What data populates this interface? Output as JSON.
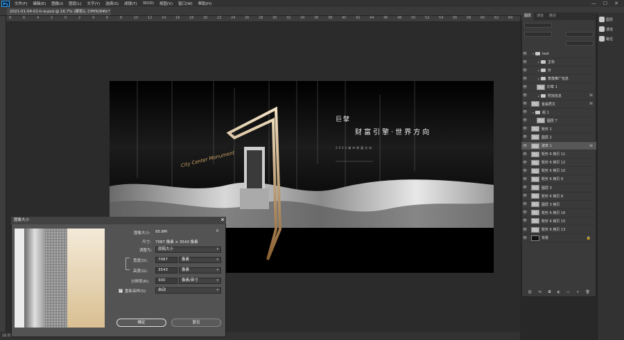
{
  "app": {
    "logo_text": "Ps",
    "menu": [
      "文件(F)",
      "编辑(E)",
      "图像(I)",
      "图层(L)",
      "文字(Y)",
      "选择(S)",
      "滤镜(T)",
      "3D(D)",
      "视图(V)",
      "窗口(W)",
      "帮助(H)"
    ],
    "window_controls": [
      "—",
      "☐",
      "✕"
    ]
  },
  "document": {
    "tab_title": "2021-01-04-01-h-w.psd @ 16.7% (建筑1, CMYK/8#) *",
    "tab_close": "×",
    "status_text": "16.67%"
  },
  "ruler": {
    "top_labels": [
      "8",
      "6",
      "4",
      "2",
      "0",
      "2",
      "4",
      "6",
      "8",
      "10",
      "12",
      "14",
      "16",
      "18",
      "20",
      "22",
      "24",
      "26",
      "28",
      "30",
      "32",
      "34",
      "36",
      "38",
      "40",
      "42",
      "44",
      "46",
      "48",
      "50",
      "52",
      "54",
      "56",
      "58",
      "60",
      "62",
      "64"
    ]
  },
  "artwork": {
    "headline": "巨擘",
    "tagline": "财富引擎·世界方向",
    "subline": "2021城市财富方向",
    "script_text": "City Center Monument"
  },
  "layers_panel": {
    "tabs": [
      "图层",
      "通道",
      "路径"
    ],
    "footer_icons": [
      "link-icon",
      "fx-icon",
      "mask-icon",
      "adjustment-icon",
      "group-icon",
      "new-layer-icon",
      "trash-icon"
    ],
    "footer_glyphs": [
      "⛓",
      "fx",
      "◘",
      "◐",
      "▭",
      "+",
      "🗑"
    ],
    "layers": [
      {
        "name": "text",
        "kind": "group",
        "indent": 0,
        "open": true
      },
      {
        "name": "主标",
        "kind": "group",
        "indent": 1
      },
      {
        "name": "价",
        "kind": "group",
        "indent": 1
      },
      {
        "name": "角落推广信息",
        "kind": "group",
        "indent": 1
      },
      {
        "name": "印章 1",
        "kind": "layer",
        "indent": 1,
        "thumb": "light"
      },
      {
        "name": "附加信息",
        "kind": "group",
        "indent": 1,
        "fx": true
      },
      {
        "name": "金属质文",
        "kind": "layer",
        "indent": 0,
        "thumb": "light",
        "fx": true
      },
      {
        "name": "组 1",
        "kind": "group",
        "indent": 0,
        "open": true
      },
      {
        "name": "图层 7",
        "kind": "layer",
        "indent": 1,
        "thumb": "light"
      },
      {
        "name": "矩形 1",
        "kind": "layer",
        "indent": 0,
        "thumb": "light"
      },
      {
        "name": "图层 2",
        "kind": "layer",
        "indent": 0,
        "thumb": "light"
      },
      {
        "name": "建筑 1",
        "kind": "layer",
        "indent": 0,
        "thumb": "light",
        "fx": true,
        "selected": true
      },
      {
        "name": "矩形 6 拷贝 11",
        "kind": "layer",
        "indent": 0,
        "thumb": "light"
      },
      {
        "name": "矩形 6 拷贝 12",
        "kind": "layer",
        "indent": 0,
        "thumb": "light"
      },
      {
        "name": "矩形 6 拷贝 10",
        "kind": "layer",
        "indent": 0,
        "thumb": "light"
      },
      {
        "name": "矩形 6 拷贝 9",
        "kind": "layer",
        "indent": 0,
        "thumb": "light"
      },
      {
        "name": "图层 3",
        "kind": "layer",
        "indent": 0,
        "thumb": "light"
      },
      {
        "name": "矩形 6 拷贝 8",
        "kind": "layer",
        "indent": 0,
        "thumb": "light"
      },
      {
        "name": "图层 3 拷贝",
        "kind": "layer",
        "indent": 0,
        "thumb": "light"
      },
      {
        "name": "矩形 6 拷贝 16",
        "kind": "layer",
        "indent": 0,
        "thumb": "light"
      },
      {
        "name": "矩形 6 拷贝 15",
        "kind": "layer",
        "indent": 0,
        "thumb": "light"
      },
      {
        "name": "矩形 6 拷贝 13",
        "kind": "layer",
        "indent": 0,
        "thumb": "light"
      },
      {
        "name": "背景",
        "kind": "layer",
        "indent": 0,
        "thumb": "dark",
        "locked": true
      }
    ]
  },
  "side_panel": {
    "items": [
      {
        "icon": "layers-icon",
        "label": "图层"
      },
      {
        "icon": "channels-icon",
        "label": "通道"
      },
      {
        "icon": "paths-icon",
        "label": "路径"
      }
    ]
  },
  "image_size_dialog": {
    "title": "图像大小",
    "close": "✕",
    "image_size_label": "图像大小:",
    "image_size_value": "95.8M",
    "dimensions_label": "尺寸:",
    "dimensions_value": "7087 像素 × 3543 像素",
    "fit_to_label": "调整为:",
    "fit_to_value": "原稿大小",
    "width_label": "宽度(D):",
    "width_value": "7087",
    "width_unit": "像素",
    "height_label": "高度(G):",
    "height_value": "3543",
    "height_unit": "像素",
    "resolution_label": "分辨率(R):",
    "resolution_value": "300",
    "resolution_unit": "像素/英寸",
    "resample_label": "重新采样(S):",
    "resample_checked": true,
    "resample_value": "自动",
    "ok_label": "确定",
    "reset_label": "复位"
  },
  "colors": {
    "accent": "#31a8ff",
    "gold": "#c9a063",
    "selected_layer": "#575757"
  }
}
